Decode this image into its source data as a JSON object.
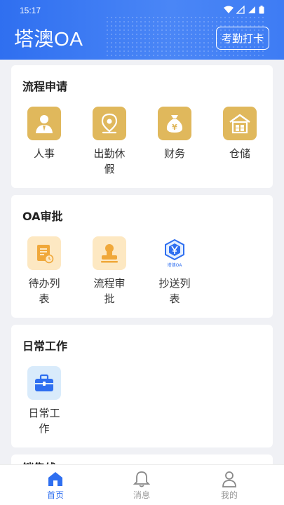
{
  "status_bar": {
    "time": "15:17"
  },
  "header": {
    "title": "塔澳OA",
    "checkin_label": "考勤打卡"
  },
  "sections": [
    {
      "title": "流程申请",
      "items": [
        {
          "label": "人事",
          "icon": "person-icon"
        },
        {
          "label": "出勤休假",
          "icon": "location-pin-icon"
        },
        {
          "label": "财务",
          "icon": "money-bag-icon"
        },
        {
          "label": "仓储",
          "icon": "warehouse-icon"
        }
      ]
    },
    {
      "title": "OA审批",
      "items": [
        {
          "label": "待办列表",
          "icon": "todo-document-icon"
        },
        {
          "label": "流程审批",
          "icon": "stamp-icon"
        },
        {
          "label": "抄送列表",
          "icon": "app-logo-icon",
          "logo_text": "塔澳OA"
        }
      ]
    },
    {
      "title": "日常工作",
      "items": [
        {
          "label": "日常工作",
          "icon": "briefcase-icon"
        }
      ]
    },
    {
      "title": "销售线"
    }
  ],
  "tabbar": [
    {
      "label": "首页",
      "icon": "home-icon",
      "active": true
    },
    {
      "label": "消息",
      "icon": "bell-icon",
      "active": false
    },
    {
      "label": "我的",
      "icon": "user-icon",
      "active": false
    }
  ],
  "colors": {
    "primary": "#2f6ff0",
    "gold_icon_bg": "#e0b85c",
    "pale_orange_bg": "#fde8c2",
    "pale_blue_bg": "#d9ebfb"
  }
}
